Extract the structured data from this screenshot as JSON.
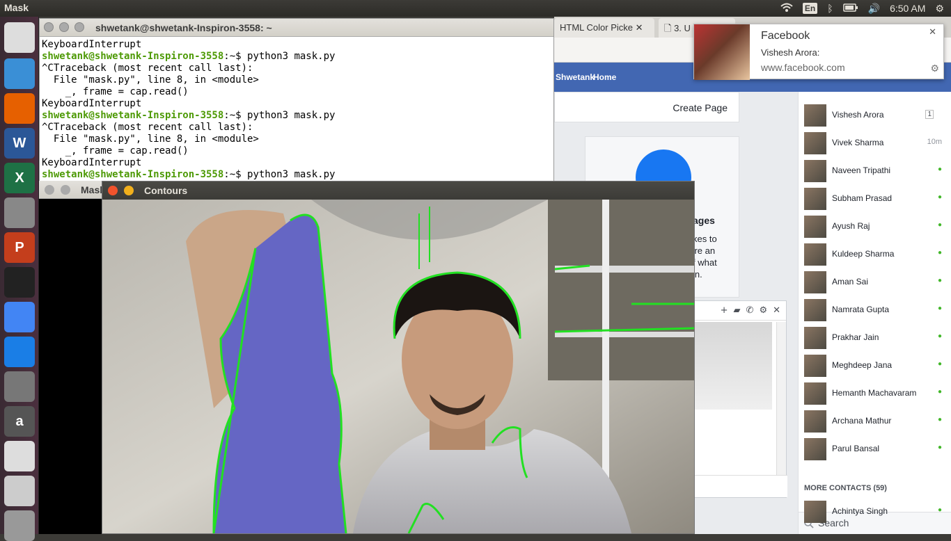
{
  "topbar": {
    "app_title": "Mask",
    "lang": "En",
    "time": "6:50 AM"
  },
  "launcher": [
    {
      "name": "ubuntu-logo-icon",
      "glyph": "",
      "color": "#ddd"
    },
    {
      "name": "files-icon",
      "glyph": "",
      "color": "#3a8fd6"
    },
    {
      "name": "firefox-icon",
      "glyph": "",
      "color": "#e66000"
    },
    {
      "name": "word-icon",
      "glyph": "W",
      "color": "#2b5797"
    },
    {
      "name": "excel-icon",
      "glyph": "X",
      "color": "#1e7145"
    },
    {
      "name": "rocket-icon",
      "glyph": "",
      "color": "#888"
    },
    {
      "name": "powerpoint-icon",
      "glyph": "P",
      "color": "#c43e1c"
    },
    {
      "name": "terminal-icon",
      "glyph": "",
      "color": "#222"
    },
    {
      "name": "chrome-icon",
      "glyph": "",
      "color": "#4285f4"
    },
    {
      "name": "app-store-icon",
      "glyph": "",
      "color": "#1a7ee6"
    },
    {
      "name": "settings-icon",
      "glyph": "",
      "color": "#777"
    },
    {
      "name": "amazon-icon",
      "glyph": "a",
      "color": "#555"
    },
    {
      "name": "text-editor-icon",
      "glyph": "",
      "color": "#ddd"
    },
    {
      "name": "installer-icon",
      "glyph": "",
      "color": "#ccc"
    },
    {
      "name": "trash-icon",
      "glyph": "",
      "color": "#999"
    }
  ],
  "terminal": {
    "title": "shwetank@shwetank-Inspiron-3558: ~",
    "prompt": "shwetank@shwetank-Inspiron-3558",
    "lines": [
      {
        "type": "text",
        "text": "KeyboardInterrupt"
      },
      {
        "type": "prompt",
        "cmd": ":~$ python3 mask.py"
      },
      {
        "type": "text",
        "text": "^CTraceback (most recent call last):"
      },
      {
        "type": "text",
        "text": "  File \"mask.py\", line 8, in <module>"
      },
      {
        "type": "text",
        "text": "    _, frame = cap.read()"
      },
      {
        "type": "text",
        "text": "KeyboardInterrupt"
      },
      {
        "type": "prompt",
        "cmd": ":~$ python3 mask.py"
      },
      {
        "type": "text",
        "text": "^CTraceback (most recent call last):"
      },
      {
        "type": "text",
        "text": "  File \"mask.py\", line 8, in <module>"
      },
      {
        "type": "text",
        "text": "    _, frame = cap.read()"
      },
      {
        "type": "text",
        "text": "KeyboardInterrupt"
      },
      {
        "type": "prompt",
        "cmd": ":~$ python3 mask.py"
      }
    ]
  },
  "mask_window": {
    "title": "Mask"
  },
  "contours_window": {
    "title": "Contours"
  },
  "browser": {
    "tabs": [
      {
        "label": "HTML Color Picke"
      },
      {
        "label": "3. U"
      }
    ],
    "user": "Shwetank",
    "home": "Home",
    "create_page": "Create Page",
    "card_title": "ages",
    "card_lines": "kes to\n're an\nf what\nin.",
    "contacts": [
      {
        "name": "Vishesh Arora",
        "status": "1"
      },
      {
        "name": "Vivek Sharma",
        "status": "10m"
      },
      {
        "name": "Naveen Tripathi",
        "status": "●"
      },
      {
        "name": "Subham Prasad",
        "status": "●"
      },
      {
        "name": "Ayush Raj",
        "status": "●"
      },
      {
        "name": "Kuldeep Sharma",
        "status": "●"
      },
      {
        "name": "Aman Sai",
        "status": "●"
      },
      {
        "name": "Namrata Gupta",
        "status": "●"
      },
      {
        "name": "Prakhar Jain",
        "status": "●"
      },
      {
        "name": "Meghdeep Jana",
        "status": "●"
      },
      {
        "name": "Hemanth Machavaram",
        "status": "●"
      },
      {
        "name": "Archana Mathur",
        "status": "●"
      },
      {
        "name": "Parul Bansal",
        "status": "●"
      }
    ],
    "more_contacts": "MORE CONTACTS (59)",
    "more_contact": {
      "name": "Achintya Singh",
      "status": "●"
    },
    "search": "Search"
  },
  "notification": {
    "title": "Facebook",
    "body": "Vishesh Arora: ",
    "source": "www.facebook.com"
  }
}
